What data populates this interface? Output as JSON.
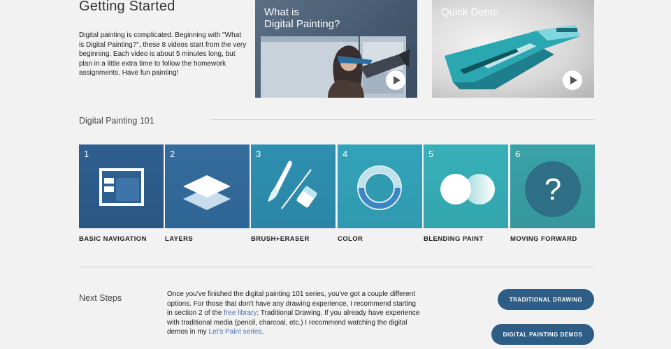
{
  "getting_started": {
    "title": "Getting Started",
    "intro": "Digital painting is complicated.  Beginning with \"What is Digital Painting?\", these 8 videos start from the very beginning.  Each video  is about 5 minutes long, but plan in a little extra time to follow the homework assignments.  Have fun painting!"
  },
  "videos": [
    {
      "title": "What is\nDigital Painting?",
      "icon": "play-icon"
    },
    {
      "title": "Quick Demo",
      "icon": "play-icon"
    }
  ],
  "course": {
    "title": "Digital Painting 101",
    "lessons": [
      {
        "number": "1",
        "label": "BASIC NAVIGATION",
        "icon": "window-icon",
        "color": "#2f5f8f"
      },
      {
        "number": "2",
        "label": "LAYERS",
        "icon": "layers-icon",
        "color": "#346c9c"
      },
      {
        "number": "3",
        "label": "BRUSH+ERASER",
        "icon": "brush-eraser-icon",
        "color": "#2f8fb0"
      },
      {
        "number": "4",
        "label": "COLOR",
        "icon": "color-ring-icon",
        "color": "#33a3b9"
      },
      {
        "number": "5",
        "label": "BLENDING PAINT",
        "icon": "blend-circles-icon",
        "color": "#38b0b8"
      },
      {
        "number": "6",
        "label": "MOVING FORWARD",
        "icon": "question-icon",
        "color": "#3aa2a7"
      }
    ]
  },
  "next_steps": {
    "title": "Next Steps",
    "text_1": "Once you've finished the digital painting 101 series, you've got a couple different options.  For those that don't have any drawing experience, I recommend starting in section 2 of the ",
    "link_1": "free library",
    "text_2": ":  Traditional Drawing.   If you already have experience with traditional media (pencil, charcoal, etc.) I recommend watching the digital demos in my ",
    "link_2": "Let's Paint series",
    "text_3": ".",
    "buttons": {
      "traditional": "TRADITIONAL DRAWING",
      "demos": "DIGITAL PAINTING DEMOS"
    }
  },
  "colors": {
    "button": "#2e5e86",
    "link": "#4a6fb5",
    "background": "#f2f2f2"
  }
}
